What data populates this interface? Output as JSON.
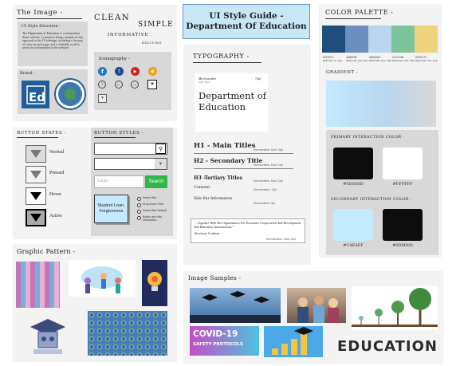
{
  "colors": {
    "panel": "#f3f3f3",
    "dark_navy": "#1e4f7c",
    "mid_blue": "#6b8fbf",
    "light_blue": "#b9d6ee",
    "green": "#7cc49b",
    "yellow": "#efd27c",
    "title_bg": "#c7e6f6",
    "primary_dark": "#0d0d0d",
    "primary_light": "#ffffff",
    "secondary_light": "#c4eaff",
    "secondary_dark": "#0d0d0d",
    "search_green": "#2fb84a"
  },
  "image": {
    "heading": "The Image -",
    "direction_heading": "UI Style Direction -",
    "direction_body": "The Department of Education is a information dense website. I wanted to bring a simple yet fun approach to the UI redesign, including a fun pop of color on each page, and a clickable scroll to search for information in the website!",
    "brand_label": "Brand -",
    "words": [
      "CLEAN",
      "SIMPLE",
      "INFORMATIVE",
      "EXCITING"
    ],
    "iconography_label": "Iconography -"
  },
  "title": {
    "line1": "UI Style Guide -",
    "line2": "Department Of Education"
  },
  "typography": {
    "heading": "TYPOGRAPHY -",
    "sample_font": "Merriweather",
    "sample_font_size": "72pt",
    "sample_subtitle": "Sans Type",
    "sample_text_1": "Department of",
    "sample_text_2": "Education",
    "h1": "H1 - Main Titles",
    "h2": "H2 - Secondary Title",
    "h3": "H3 -Tertiary Titles",
    "content": "Content",
    "side_bar": "Side Bar Information",
    "h1_meta": "Merriweather, Bold 18pt",
    "h2_meta": "Merriweather, Bold 14pt",
    "h3_meta": "Merriweather, Bold 12pt",
    "content_meta": "Merriweather, 10pt",
    "side_meta": "Merriweather, 8pt",
    "quote": "\"...Together With The Organization For Economic Cooperation And Development And Education International.\"",
    "quote_author": "-Secretary Cardona",
    "quote_meta": "Merriweather, Italic 10pt"
  },
  "palette": {
    "heading": "COLOR PALETTE -",
    "swatches": [
      {
        "color": "#1e4f7c",
        "hex": "#1E4F7C",
        "rgb": "RGB (30, 79, 124)"
      },
      {
        "color": "#6b8fbf",
        "hex": "#6B8FBF",
        "rgb": "RGB (107, 143, 191)"
      },
      {
        "color": "#b9d6ee",
        "hex": "#B9D6EE",
        "rgb": "RGB (185, 214, 238)"
      },
      {
        "color": "#7cc49b",
        "hex": "#7CC49B",
        "rgb": "RGB (124, 196, 155)"
      },
      {
        "color": "#efd27c",
        "hex": "#EFD27C",
        "rgb": "RGB (239, 210, 124)"
      }
    ],
    "gradient_label": "GRADIENT -",
    "primary_label": "PRIMARY INTERACTION COLOR -",
    "primary": [
      {
        "hex": "#0d0d0d",
        "label": "#0D0D0D"
      },
      {
        "hex": "#ffffff",
        "label": "#FFFFFF"
      }
    ],
    "secondary_label": "SECONDARY INTERACTION COLOR -",
    "secondary": [
      {
        "hex": "#c4eaff",
        "label": "#C4EAFF"
      },
      {
        "hex": "#0d0d0d",
        "label": "#0D0D0D"
      }
    ]
  },
  "button_states": {
    "heading": "BUTTON STATES -",
    "states": [
      "Normal",
      "Pressed",
      "Hover",
      "Active"
    ]
  },
  "button_styles": {
    "heading": "BUTTON STYLES -",
    "search_placeholder": "Schiha",
    "search_button": "Search",
    "cta": "Student Loan, Forgiveness",
    "bullets": [
      "Search Bar",
      "Drop Down Field",
      "Search Bar Default",
      "Button and Info Information"
    ]
  },
  "graphic_pattern": {
    "heading": "Graphic Pattern -"
  },
  "image_samples": {
    "heading": "Image Samples -",
    "covid_line1": "COVID-19",
    "covid_line2": "SAFETY PROTOCOLS",
    "education_word": "EDUCATION"
  }
}
